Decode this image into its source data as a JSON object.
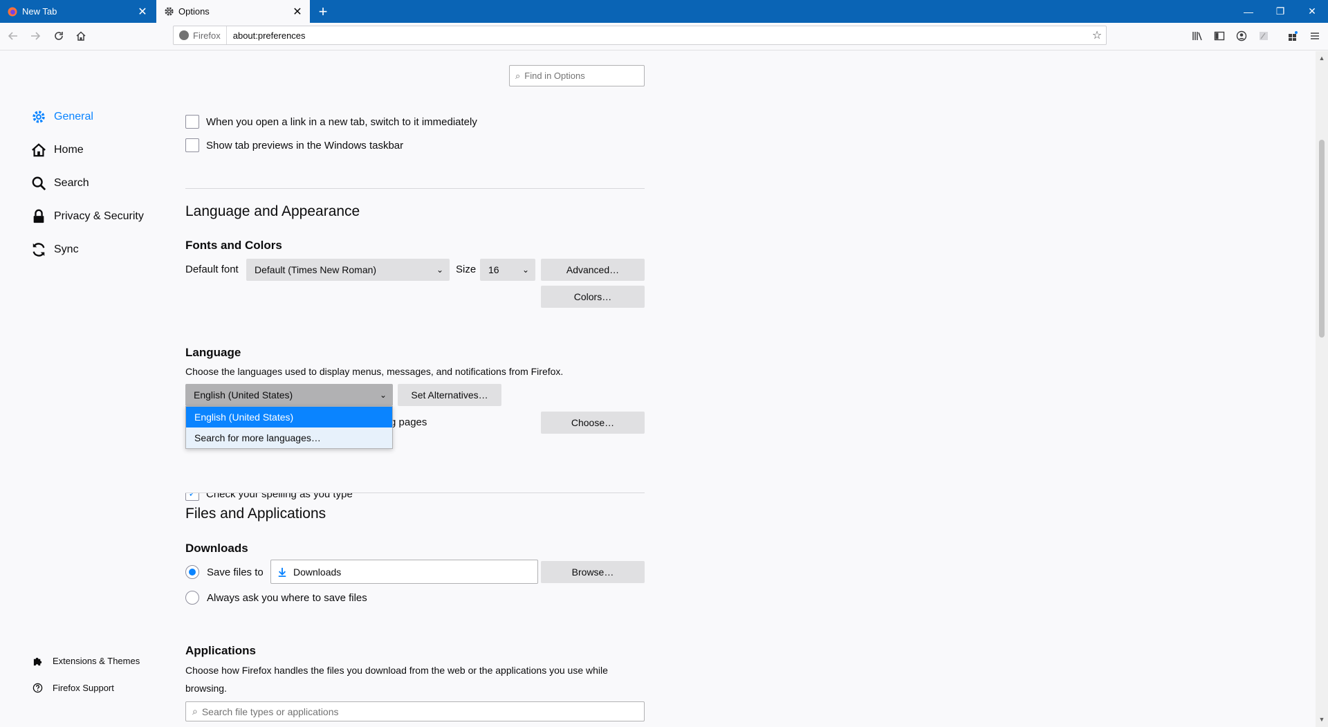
{
  "tabs": [
    {
      "label": "New Tab",
      "icon": "firefox-icon",
      "active": false
    },
    {
      "label": "Options",
      "icon": "gear-icon",
      "active": true
    }
  ],
  "urlbar": {
    "identity": "Firefox",
    "url": "about:preferences"
  },
  "sidebar": {
    "items": [
      {
        "label": "General",
        "icon": "gear-icon",
        "selected": true
      },
      {
        "label": "Home",
        "icon": "home-icon",
        "selected": false
      },
      {
        "label": "Search",
        "icon": "search-icon",
        "selected": false
      },
      {
        "label": "Privacy & Security",
        "icon": "lock-icon",
        "selected": false
      },
      {
        "label": "Sync",
        "icon": "sync-icon",
        "selected": false
      }
    ],
    "footer": [
      {
        "label": "Extensions & Themes",
        "icon": "puzzle-icon"
      },
      {
        "label": "Firefox Support",
        "icon": "help-icon"
      }
    ]
  },
  "find": {
    "placeholder": "Find in Options"
  },
  "tabs_section": {
    "switch_new_tab": "When you open a link in a new tab, switch to it immediately",
    "tab_previews": "Show tab previews in the Windows taskbar"
  },
  "language_appearance": {
    "heading": "Language and Appearance",
    "fonts_heading": "Fonts and Colors",
    "default_font_label": "Default font",
    "default_font_value": "Default (Times New Roman)",
    "size_label": "Size",
    "size_value": "16",
    "advanced_button": "Advanced…",
    "colors_button": "Colors…"
  },
  "language": {
    "heading": "Language",
    "description": "Choose the languages used to display menus, messages, and notifications from Firefox.",
    "selected": "English (United States)",
    "set_alternatives": "Set Alternatives…",
    "dropdown_options": [
      "English (United States)",
      "Search for more languages…"
    ],
    "pages_text_fragment": "g pages",
    "choose_button": "Choose…",
    "spelling_fragment": "Check your spelling as you type"
  },
  "files_apps": {
    "heading": "Files and Applications",
    "downloads_heading": "Downloads",
    "save_files_label": "Save files to",
    "folder": "Downloads",
    "browse_button": "Browse…",
    "always_ask": "Always ask you where to save files",
    "applications_heading": "Applications",
    "applications_desc_line1": "Choose how Firefox handles the files you download from the web or the applications you use while",
    "applications_desc_line2": "browsing.",
    "search_apps_placeholder": "Search file types or applications"
  },
  "colors": {
    "accent": "#0a84ff",
    "titlebar": "#0a64b5"
  }
}
